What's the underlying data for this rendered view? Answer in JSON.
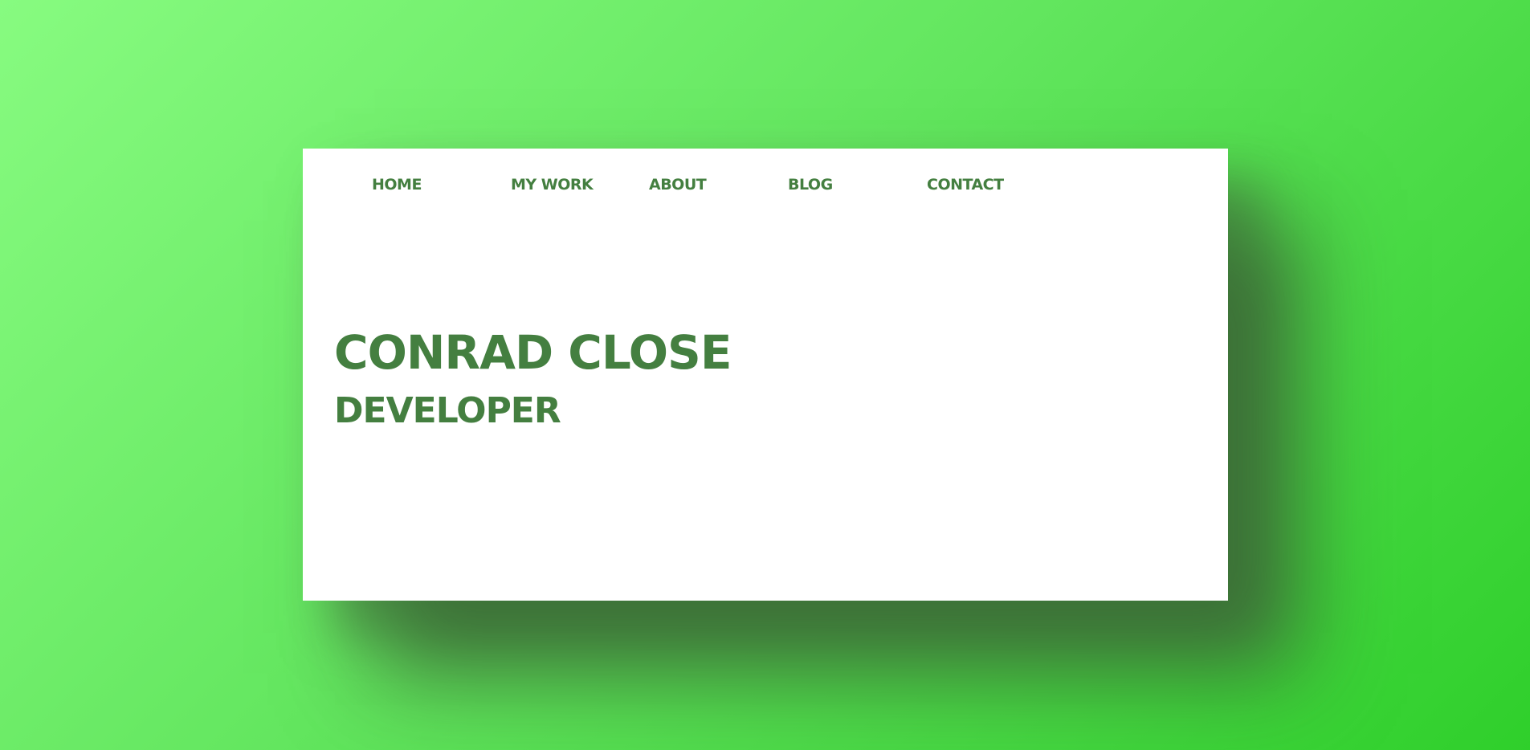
{
  "nav": {
    "items": [
      {
        "label": "Home"
      },
      {
        "label": "MY WORK"
      },
      {
        "label": "ABOUT"
      },
      {
        "label": "BLOG"
      },
      {
        "label": "CONTACT"
      }
    ]
  },
  "hero": {
    "name": "CONRAD CLOSE",
    "role": "DEVELOPER"
  },
  "colors": {
    "accent": "#447f40",
    "background_start": "#87fb80",
    "background_end": "#2fcf2b",
    "card": "#ffffff"
  }
}
